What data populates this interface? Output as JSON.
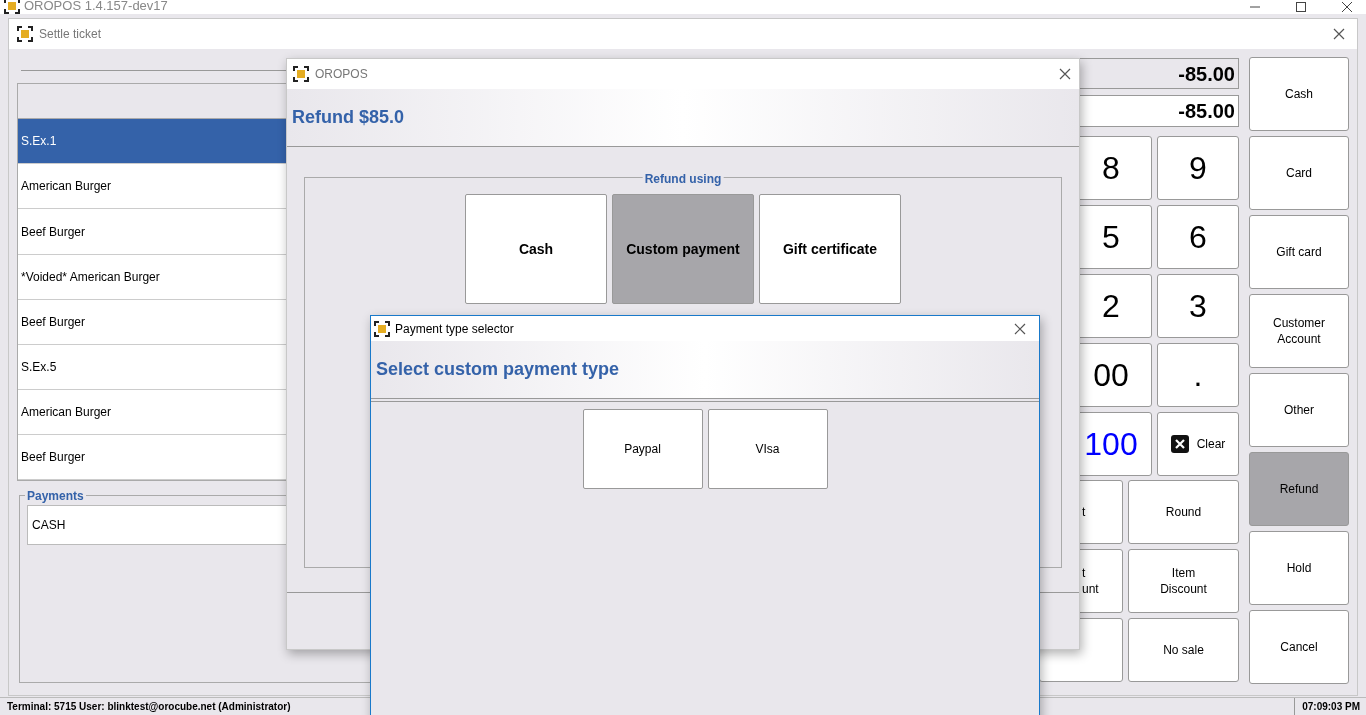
{
  "app_window": {
    "title": "OROPOS 1.4.157-dev17"
  },
  "settle_ticket": {
    "title": "Settle ticket",
    "ticket_items": [
      {
        "name": "S.Ex.1",
        "selected": true
      },
      {
        "name": "American Burger",
        "selected": false
      },
      {
        "name": "Beef Burger",
        "selected": false
      },
      {
        "name": "*Voided* American Burger",
        "selected": false
      },
      {
        "name": "Beef Burger",
        "selected": false
      },
      {
        "name": "S.Ex.5",
        "selected": false
      },
      {
        "name": "American Burger",
        "selected": false
      },
      {
        "name": "Beef Burger",
        "selected": false
      }
    ],
    "payments": {
      "title": "Payments",
      "items": [
        "CASH"
      ]
    },
    "amounts": [
      {
        "value": "-85.00",
        "kind": "total"
      },
      {
        "value": "-85.00",
        "kind": "input"
      }
    ],
    "keypad": [
      {
        "label": "8",
        "kind": "digit"
      },
      {
        "label": "9",
        "kind": "digit"
      },
      {
        "label": "5",
        "kind": "digit"
      },
      {
        "label": "6",
        "kind": "digit"
      },
      {
        "label": "2",
        "kind": "digit"
      },
      {
        "label": "3",
        "kind": "digit"
      },
      {
        "label": "00",
        "kind": "digit"
      },
      {
        "label": ".",
        "kind": "digit"
      },
      {
        "label": "100",
        "kind": "quick"
      },
      {
        "label": "Clear",
        "kind": "clear"
      }
    ],
    "actions": [
      {
        "label": "t",
        "kind": "clipped"
      },
      {
        "label": "Round",
        "kind": "full"
      },
      {
        "label": "t\nunt",
        "kind": "clipped"
      },
      {
        "label": "Item\nDiscount",
        "kind": "full"
      },
      {
        "kind": "clipped"
      },
      {
        "label": "No sale",
        "kind": "full"
      }
    ],
    "payment_buttons": [
      {
        "label": "Cash",
        "selected": false
      },
      {
        "label": "Card",
        "selected": false
      },
      {
        "label": "Gift card",
        "selected": false
      },
      {
        "label": "Customer\nAccount",
        "selected": false
      },
      {
        "label": "Other",
        "selected": false
      },
      {
        "label": "Refund",
        "selected": true
      },
      {
        "label": "Hold",
        "selected": false
      },
      {
        "label": "Cancel",
        "selected": false
      }
    ]
  },
  "refund_dialog": {
    "title": "OROPOS",
    "heading": "Refund $85.0",
    "group_title": "Refund using",
    "methods": [
      {
        "label": "Cash",
        "selected": false
      },
      {
        "label": "Custom payment",
        "selected": true
      },
      {
        "label": "Gift certificate",
        "selected": false
      }
    ]
  },
  "payment_type_selector": {
    "title": "Payment type selector",
    "heading": "Select custom payment type",
    "types": [
      "Paypal",
      "VIsa"
    ]
  },
  "status_bar": {
    "session": "Terminal: 5715 User: blinktest@orocube.net  (Administrator)",
    "time": "07:09:03 PM"
  }
}
